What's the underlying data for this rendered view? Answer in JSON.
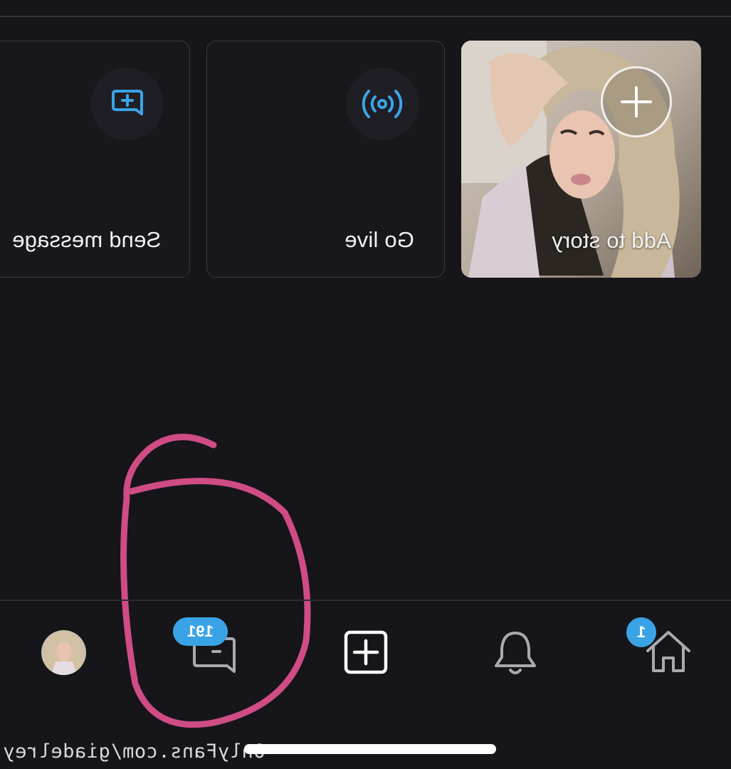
{
  "quick_actions": {
    "send_message": {
      "label": "Send message",
      "icon": "new-message-icon"
    },
    "go_live": {
      "label": "Go live",
      "icon": "broadcast-icon"
    },
    "add_to_story": {
      "label": "Add to story",
      "icon": "plus-icon"
    }
  },
  "bottom_nav": {
    "items": [
      {
        "name": "profile",
        "icon": "avatar"
      },
      {
        "name": "messages",
        "icon": "chat-icon",
        "badge": "191"
      },
      {
        "name": "create",
        "icon": "plus-square-icon"
      },
      {
        "name": "notifications",
        "icon": "bell-icon"
      },
      {
        "name": "home",
        "icon": "home-icon",
        "badge": "1"
      }
    ]
  },
  "watermark": "OnlyFans.com/giadelrey",
  "colors": {
    "background": "#161519",
    "accent": "#3aa3e6",
    "annotation": "#d94f8a"
  }
}
